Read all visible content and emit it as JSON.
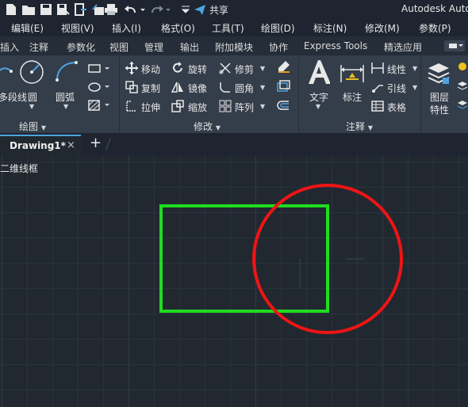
{
  "app": {
    "title": "Autodesk Auto",
    "share_label": "共享"
  },
  "menubar": [
    "编辑(E)",
    "视图(V)",
    "插入(I)",
    "格式(O)",
    "工具(T)",
    "绘图(D)",
    "标注(N)",
    "修改(M)",
    "参数(P)"
  ],
  "ribbon_tabs": [
    "插入",
    "注释",
    "参数化",
    "视图",
    "管理",
    "输出",
    "附加模块",
    "协作",
    "Express Tools",
    "精选应用"
  ],
  "panels": {
    "draw": {
      "title": "绘图",
      "polyline": "多段线",
      "circle": "圆",
      "arc": "圆弧"
    },
    "modify": {
      "title": "修改",
      "move": "移动",
      "rotate": "旋转",
      "trim": "修剪",
      "copy": "复制",
      "mirror": "镜像",
      "fillet": "圆角",
      "stretch": "拉伸",
      "scale": "缩放",
      "array": "阵列"
    },
    "annotation": {
      "title": "注释",
      "text": "文字",
      "dimension": "标注",
      "linear": "线性",
      "leader": "引线",
      "table": "表格"
    },
    "layers": {
      "properties_line1": "图层",
      "properties_line2": "特性"
    }
  },
  "document_tab": {
    "name": "Drawing1*",
    "close": "×",
    "new": "+"
  },
  "viewport_label": "二维线框",
  "drawing": {
    "rectangle_color": "#1fdc1f",
    "circle_color": "#f01414"
  },
  "colors": {
    "accent": "#4fa3e0",
    "background": "#212830"
  }
}
